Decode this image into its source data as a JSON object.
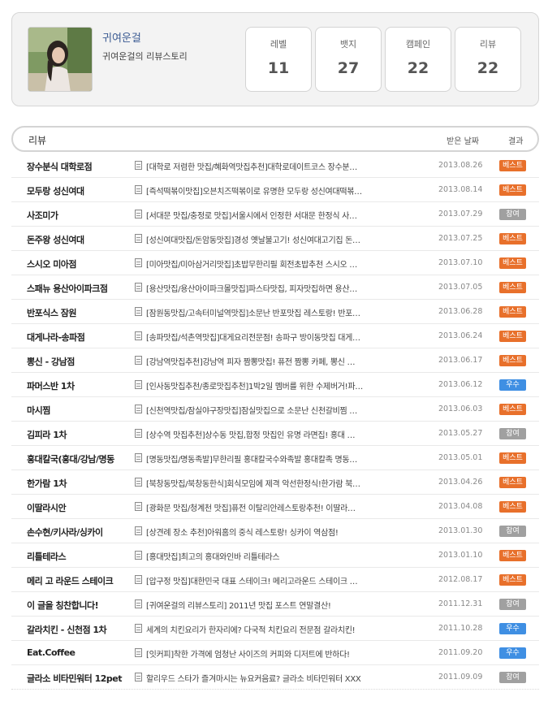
{
  "profile": {
    "name": "귀여운걸",
    "description": "귀여운걸의 리뷰스토리",
    "stats": [
      {
        "label": "레벨",
        "value": "11"
      },
      {
        "label": "뱃지",
        "value": "27"
      },
      {
        "label": "캠페인",
        "value": "22"
      },
      {
        "label": "리뷰",
        "value": "22"
      }
    ]
  },
  "list": {
    "headers": {
      "review": "리뷰",
      "date": "받은 날짜",
      "result": "결과"
    },
    "rows": [
      {
        "name": "장수분식 대학로점",
        "title": "[대학로 저렴한 맛집/혜화역맛집추천]대학로데이트코스 장수분…",
        "date": "2013.08.26",
        "result": "베스트",
        "type": "best"
      },
      {
        "name": "모두랑 성신여대",
        "title": "[즉석떡볶이맛집]오븐치즈떡볶이로 유명한 모두랑 성신여대떡볶…",
        "date": "2013.08.14",
        "result": "베스트",
        "type": "best"
      },
      {
        "name": "사조미가",
        "title": "[서대문 맛집/충정로 맛집]서울시에서 인정한 서대문 한정식 사…",
        "date": "2013.07.29",
        "result": "참여",
        "type": "join"
      },
      {
        "name": "돈주왕 성신여대",
        "title": "[성신여대맛집/돈암동맛집]경성 옛날불고기! 성신여대고기집 돈…",
        "date": "2013.07.25",
        "result": "베스트",
        "type": "best"
      },
      {
        "name": "스시오 미아점",
        "title": "[미아맛집/미아삼거리맛집]초밥무한리필 회전초밥추천 스시오 …",
        "date": "2013.07.10",
        "result": "베스트",
        "type": "best"
      },
      {
        "name": "스패뉴 용산아이파크점",
        "title": "[용산맛집/용산아이파크몰맛집]파스타맛집, 피자맛집하면 용산…",
        "date": "2013.07.05",
        "result": "베스트",
        "type": "best"
      },
      {
        "name": "반포식스 잠원",
        "title": "[잠원동맛집/고속터미널역맛집]소문난 반포맛집 레스토랑! 반포…",
        "date": "2013.06.28",
        "result": "베스트",
        "type": "best"
      },
      {
        "name": "대게나라-송파점",
        "title": "[송파맛집/석촌역맛집]대게요리전문점! 송파구 방이동맛집 대게…",
        "date": "2013.06.24",
        "result": "베스트",
        "type": "best"
      },
      {
        "name": "뽕신 - 강남점",
        "title": "[강남역맛집추천]강남역 피자 짬뽕맛집! 퓨전 짬뽕 카페, 뽕신 …",
        "date": "2013.06.17",
        "result": "베스트",
        "type": "best"
      },
      {
        "name": "파머스반 1차",
        "title": "[인사동맛집추천/종로맛집추천]1박2일 멤버를 위한 수제버거!파…",
        "date": "2013.06.12",
        "result": "우수",
        "type": "good"
      },
      {
        "name": "마시찜",
        "title": "[신천역맛집/잠실야구장맛집]잠실맛집으로 소문난 신천갈비찜 …",
        "date": "2013.06.03",
        "result": "베스트",
        "type": "best"
      },
      {
        "name": "김피라 1차",
        "title": "[상수역 맛집추천]상수동 맛집,합정 맛집인 유명 라면집! 홍대 …",
        "date": "2013.05.27",
        "result": "참여",
        "type": "join"
      },
      {
        "name": "홍대칼국(홍대/강남/명동",
        "title": "[명동맛집/명동족발]무한리필 홍대칼국수와족발 홍대칼족 명동…",
        "date": "2013.05.01",
        "result": "베스트",
        "type": "best"
      },
      {
        "name": "한가람 1차",
        "title": "[북창동맛집/북창동한식]회식모임에 제격 악선한정식!한가람 북…",
        "date": "2013.04.26",
        "result": "베스트",
        "type": "best"
      },
      {
        "name": "이딸라시안",
        "title": "[광화문 맛집/청계천 맛집]퓨전 이탈리안레스토랑추천! 이딸라…",
        "date": "2013.04.08",
        "result": "베스트",
        "type": "best"
      },
      {
        "name": "손수현/키사라/싱카이",
        "title": "[상견례 장소 추천]아워홈의 중식 레스토랑! 싱카이 역삼점!",
        "date": "2013.01.30",
        "result": "참여",
        "type": "join"
      },
      {
        "name": "리틀테라스",
        "title": "[홍대맛집]최고의 홍대와인바 리틀테라스",
        "date": "2013.01.10",
        "result": "베스트",
        "type": "best"
      },
      {
        "name": "메리 고 라운드 스테이크",
        "title": "[압구정 맛집]대한민국 대표 스테이크! 메리고라운드 스테이크 …",
        "date": "2012.08.17",
        "result": "베스트",
        "type": "best"
      },
      {
        "name": "이 글을 칭찬합니다!",
        "title": "[귀여운걸의 리뷰스토리] 2011년 맛집 포스트 연말결산!",
        "date": "2011.12.31",
        "result": "참여",
        "type": "join"
      },
      {
        "name": "갈라치킨 - 신천점 1차",
        "title": "세계의 치킨요리가 한자리에? 다국적 치킨요리 전문점 갈라치킨!",
        "date": "2011.10.28",
        "result": "우수",
        "type": "good"
      },
      {
        "name": "Eat.Coffee",
        "title": "[잇커피]착한 가격에 엄청난 사이즈의 커피와 디저트에 반하다!",
        "date": "2011.09.20",
        "result": "우수",
        "type": "good"
      },
      {
        "name": "글라소 비타민워터 12pet",
        "title": "할리우드 스타가 즐겨마시는 뉴요커음료? 글라소 비타민워터 XXX",
        "date": "2011.09.09",
        "result": "참여",
        "type": "join"
      }
    ]
  }
}
